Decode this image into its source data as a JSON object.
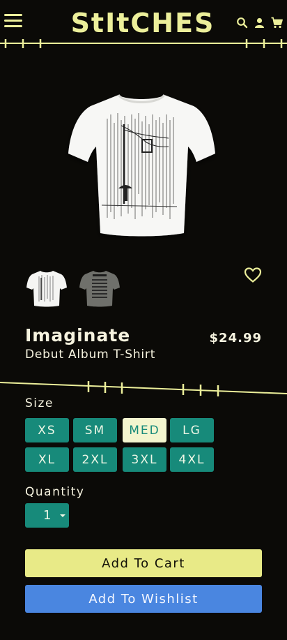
{
  "colors": {
    "background": "#0b0a07",
    "accent_yellow": "#ecef9a",
    "teal": "#178a7a",
    "selected_size_bg": "#f3f5cf",
    "cart_button": "#e8ea87",
    "wishlist_button": "#4a86e0"
  },
  "header": {
    "logo": "StItCHES",
    "icons": [
      "menu-icon",
      "search-icon",
      "user-icon",
      "cart-icon"
    ]
  },
  "product": {
    "title": "Imaginate",
    "subtitle": "Debut Album T-Shirt",
    "price": "$24.99",
    "thumbnails": [
      "white-shirt-thumbnail",
      "gray-shirt-thumbnail"
    ],
    "favorite_icon": "heart-icon"
  },
  "size": {
    "label": "Size",
    "options": [
      "XS",
      "SM",
      "MED",
      "LG",
      "XL",
      "2XL",
      "3XL",
      "4XL"
    ],
    "selected": "MED"
  },
  "quantity": {
    "label": "Quantity",
    "value": "1"
  },
  "actions": {
    "add_to_cart": "Add To Cart",
    "add_to_wishlist": "Add To Wishlist"
  }
}
